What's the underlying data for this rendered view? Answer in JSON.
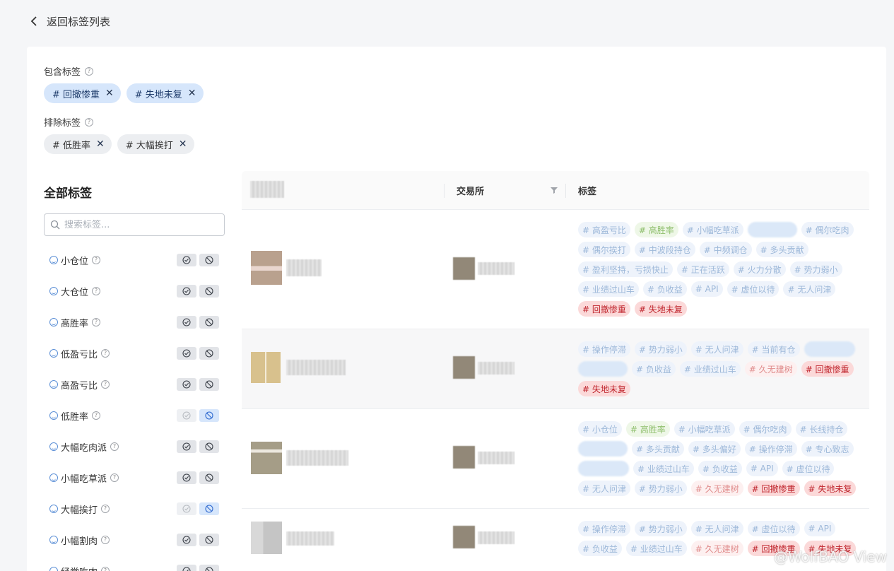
{
  "back": {
    "label": "返回标签列表"
  },
  "include": {
    "label": "包含标签",
    "chips": [
      {
        "label": "# 回撤惨重"
      },
      {
        "label": "# 失地未复"
      }
    ]
  },
  "exclude": {
    "label": "排除标签",
    "chips": [
      {
        "label": "# 低胜率"
      },
      {
        "label": "# 大幅挨打"
      }
    ]
  },
  "panel": {
    "title": "全部标签",
    "search_placeholder": "搜索标签...",
    "items": [
      {
        "name": "小仓位",
        "state": "none"
      },
      {
        "name": "大仓位",
        "state": "none"
      },
      {
        "name": "高胜率",
        "state": "none"
      },
      {
        "name": "低盈亏比",
        "state": "none"
      },
      {
        "name": "高盈亏比",
        "state": "none"
      },
      {
        "name": "低胜率",
        "state": "excluded"
      },
      {
        "name": "大幅吃肉派",
        "state": "none"
      },
      {
        "name": "小幅吃草派",
        "state": "none"
      },
      {
        "name": "大幅挨打",
        "state": "excluded"
      },
      {
        "name": "小幅割肉",
        "state": "none"
      },
      {
        "name": "经常吃肉",
        "state": "none"
      }
    ]
  },
  "table": {
    "headers": {
      "exchange": "交易所",
      "tags": "标签"
    },
    "rows": [
      {
        "tags": [
          {
            "t": "# 高盈亏比",
            "c": "blue"
          },
          {
            "t": "# 高胜率",
            "c": "green"
          },
          {
            "t": "# 小幅吃草派",
            "c": "blue"
          },
          {
            "t": "",
            "c": "blur"
          },
          {
            "t": "# 偶尔吃肉",
            "c": "blue"
          },
          {
            "t": "# 偶尔挨打",
            "c": "blue"
          },
          {
            "t": "# 中波段持仓",
            "c": "blue"
          },
          {
            "t": "# 中频调仓",
            "c": "blue"
          },
          {
            "t": "# 多头贡献",
            "c": "blue"
          },
          {
            "t": "# 盈利坚持，亏损快止",
            "c": "blue"
          },
          {
            "t": "# 正在活跃",
            "c": "blue"
          },
          {
            "t": "# 火力分散",
            "c": "blue"
          },
          {
            "t": "# 势力弱小",
            "c": "blue"
          },
          {
            "t": "# 业绩过山车",
            "c": "blue"
          },
          {
            "t": "# 负收益",
            "c": "blue"
          },
          {
            "t": "# API",
            "c": "blue"
          },
          {
            "t": "# 虚位以待",
            "c": "blue"
          },
          {
            "t": "# 无人问津",
            "c": "blue"
          },
          {
            "t": "# 回撤惨重",
            "c": "red"
          },
          {
            "t": "# 失地未复",
            "c": "red"
          }
        ]
      },
      {
        "tags": [
          {
            "t": "# 操作停滞",
            "c": "blue"
          },
          {
            "t": "# 势力弱小",
            "c": "blue"
          },
          {
            "t": "# 无人问津",
            "c": "blue"
          },
          {
            "t": "# 当前有仓",
            "c": "blue"
          },
          {
            "t": "",
            "c": "blur"
          },
          {
            "t": "",
            "c": "blur"
          },
          {
            "t": "# 负收益",
            "c": "blue"
          },
          {
            "t": "# 业绩过山车",
            "c": "blue"
          },
          {
            "t": "# 久无建树",
            "c": "pink"
          },
          {
            "t": "# 回撤惨重",
            "c": "red"
          },
          {
            "t": "# 失地未复",
            "c": "red"
          }
        ]
      },
      {
        "tags": [
          {
            "t": "# 小仓位",
            "c": "blue"
          },
          {
            "t": "# 高胜率",
            "c": "green"
          },
          {
            "t": "# 小幅吃草派",
            "c": "blue"
          },
          {
            "t": "# 偶尔吃肉",
            "c": "blue"
          },
          {
            "t": "# 长线持仓",
            "c": "blue"
          },
          {
            "t": "",
            "c": "blur"
          },
          {
            "t": "# 多头贡献",
            "c": "blue"
          },
          {
            "t": "# 多头偏好",
            "c": "blue"
          },
          {
            "t": "# 操作停滞",
            "c": "blue"
          },
          {
            "t": "# 专心致志",
            "c": "blue"
          },
          {
            "t": "",
            "c": "blur"
          },
          {
            "t": "# 业绩过山车",
            "c": "blue"
          },
          {
            "t": "# 负收益",
            "c": "blue"
          },
          {
            "t": "# API",
            "c": "blue"
          },
          {
            "t": "# 虚位以待",
            "c": "blue"
          },
          {
            "t": "# 无人问津",
            "c": "blue"
          },
          {
            "t": "# 势力弱小",
            "c": "blue"
          },
          {
            "t": "# 久无建树",
            "c": "pink"
          },
          {
            "t": "# 回撤惨重",
            "c": "red"
          },
          {
            "t": "# 失地未复",
            "c": "red"
          }
        ]
      },
      {
        "tags": [
          {
            "t": "# 操作停滞",
            "c": "blue"
          },
          {
            "t": "# 势力弱小",
            "c": "blue"
          },
          {
            "t": "# 无人问津",
            "c": "blue"
          },
          {
            "t": "# 虚位以待",
            "c": "blue"
          },
          {
            "t": "# API",
            "c": "blue"
          },
          {
            "t": "# 负收益",
            "c": "blue"
          },
          {
            "t": "# 业绩过山车",
            "c": "blue"
          },
          {
            "t": "# 久无建树",
            "c": "pink"
          },
          {
            "t": "# 回撤惨重",
            "c": "red"
          },
          {
            "t": "# 失地未复",
            "c": "red"
          }
        ]
      }
    ]
  },
  "watermark": "@WolfBAO View"
}
